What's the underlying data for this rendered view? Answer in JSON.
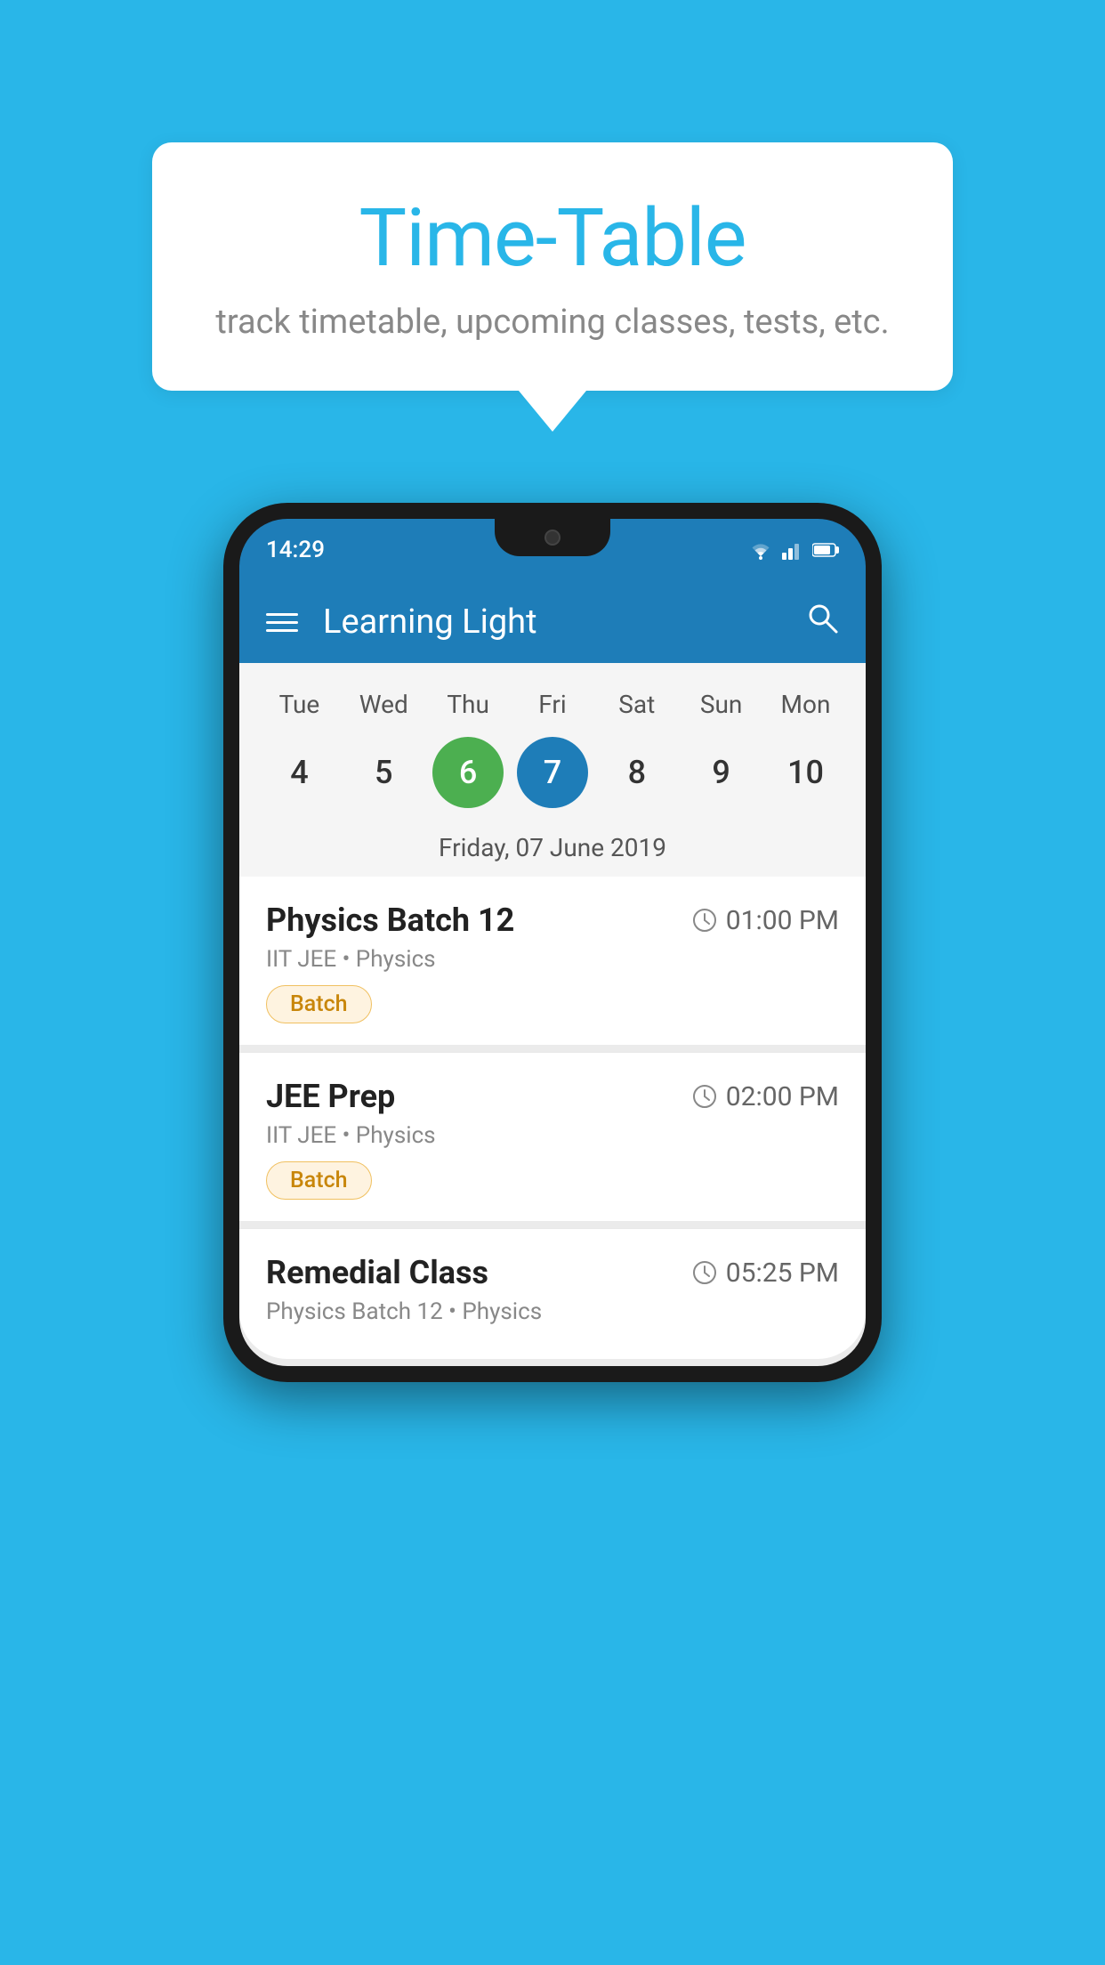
{
  "background": {
    "color": "#29b6e8"
  },
  "tooltip": {
    "title": "Time-Table",
    "subtitle": "track timetable, upcoming classes, tests, etc."
  },
  "phone": {
    "status_bar": {
      "time": "14:29",
      "icons": [
        "wifi",
        "signal",
        "battery"
      ]
    },
    "app_bar": {
      "title": "Learning Light",
      "menu_label": "menu",
      "search_label": "search"
    },
    "calendar": {
      "days": [
        "Tue",
        "Wed",
        "Thu",
        "Fri",
        "Sat",
        "Sun",
        "Mon"
      ],
      "dates": [
        "4",
        "5",
        "6",
        "7",
        "8",
        "9",
        "10"
      ],
      "today_index": 2,
      "selected_index": 3,
      "selected_label": "Friday, 07 June 2019"
    },
    "schedule": [
      {
        "title": "Physics Batch 12",
        "time": "01:00 PM",
        "subtitle": "IIT JEE • Physics",
        "badge": "Batch"
      },
      {
        "title": "JEE Prep",
        "time": "02:00 PM",
        "subtitle": "IIT JEE • Physics",
        "badge": "Batch"
      },
      {
        "title": "Remedial Class",
        "time": "05:25 PM",
        "subtitle": "Physics Batch 12 • Physics",
        "badge": ""
      }
    ]
  }
}
